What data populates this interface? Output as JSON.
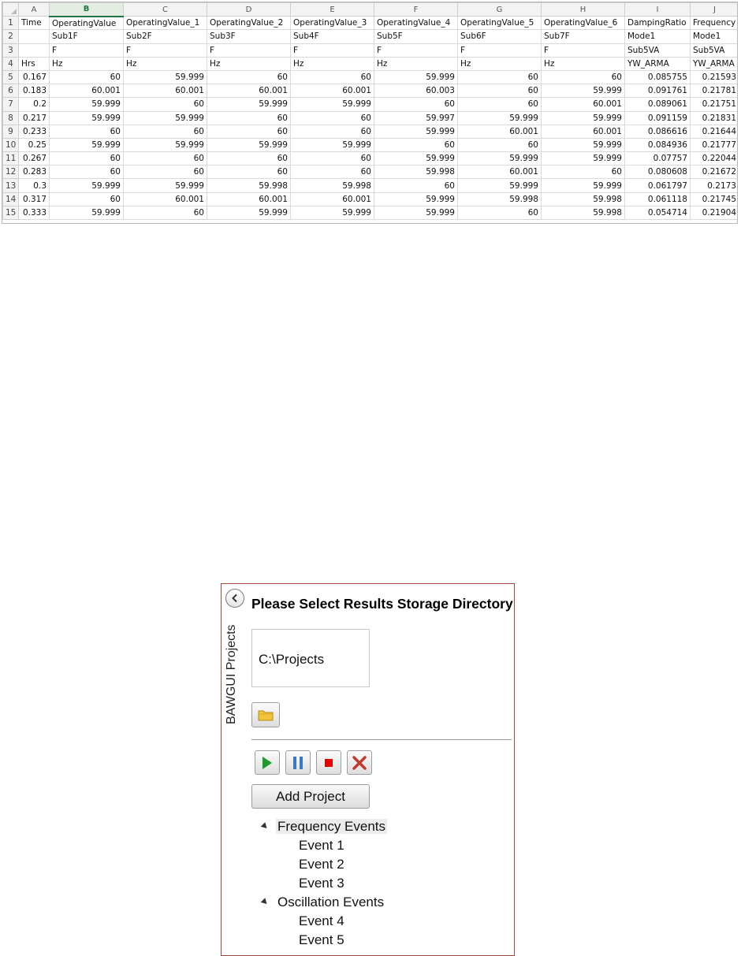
{
  "sheet": {
    "col_letters": [
      "A",
      "B",
      "C",
      "D",
      "E",
      "F",
      "G",
      "H",
      "I",
      "J"
    ],
    "rows": [
      {
        "n": "1",
        "cells": [
          "Time",
          "OperatingValue",
          "OperatingValue_1",
          "OperatingValue_2",
          "OperatingValue_3",
          "OperatingValue_4",
          "OperatingValue_5",
          "OperatingValue_6",
          "DampingRatio",
          "Frequency"
        ]
      },
      {
        "n": "2",
        "cells": [
          "",
          "Sub1F",
          "Sub2F",
          "Sub3F",
          "Sub4F",
          "Sub5F",
          "Sub6F",
          "Sub7F",
          "Mode1",
          "Mode1"
        ]
      },
      {
        "n": "3",
        "cells": [
          "",
          "F",
          "F",
          "F",
          "F",
          "F",
          "F",
          "F",
          "Sub5VA",
          "Sub5VA"
        ]
      },
      {
        "n": "4",
        "cells": [
          "Hrs",
          "Hz",
          "Hz",
          "Hz",
          "Hz",
          "Hz",
          "Hz",
          "Hz",
          "YW_ARMA",
          "YW_ARMA"
        ]
      },
      {
        "n": "5",
        "cells": [
          "0.167",
          "60",
          "59.999",
          "60",
          "60",
          "59.999",
          "60",
          "60",
          "0.085755",
          "0.21593"
        ]
      },
      {
        "n": "6",
        "cells": [
          "0.183",
          "60.001",
          "60.001",
          "60.001",
          "60.001",
          "60.003",
          "60",
          "59.999",
          "0.091761",
          "0.21781"
        ]
      },
      {
        "n": "7",
        "cells": [
          "0.2",
          "59.999",
          "60",
          "59.999",
          "59.999",
          "60",
          "60",
          "60.001",
          "0.089061",
          "0.21751"
        ]
      },
      {
        "n": "8",
        "cells": [
          "0.217",
          "59.999",
          "59.999",
          "60",
          "60",
          "59.997",
          "59.999",
          "59.999",
          "0.091159",
          "0.21831"
        ]
      },
      {
        "n": "9",
        "cells": [
          "0.233",
          "60",
          "60",
          "60",
          "60",
          "59.999",
          "60.001",
          "60.001",
          "0.086616",
          "0.21644"
        ]
      },
      {
        "n": "10",
        "cells": [
          "0.25",
          "59.999",
          "59.999",
          "59.999",
          "59.999",
          "60",
          "60",
          "59.999",
          "0.084936",
          "0.21777"
        ]
      },
      {
        "n": "11",
        "cells": [
          "0.267",
          "60",
          "60",
          "60",
          "60",
          "59.999",
          "59.999",
          "59.999",
          "0.07757",
          "0.22044"
        ]
      },
      {
        "n": "12",
        "cells": [
          "0.283",
          "60",
          "60",
          "60",
          "60",
          "59.998",
          "60.001",
          "60",
          "0.080608",
          "0.21672"
        ]
      },
      {
        "n": "13",
        "cells": [
          "0.3",
          "59.999",
          "59.999",
          "59.998",
          "59.998",
          "60",
          "59.999",
          "59.999",
          "0.061797",
          "0.2173"
        ]
      },
      {
        "n": "14",
        "cells": [
          "0.317",
          "60",
          "60.001",
          "60.001",
          "60.001",
          "59.999",
          "59.998",
          "59.998",
          "0.061118",
          "0.21745"
        ]
      },
      {
        "n": "15",
        "cells": [
          "0.333",
          "59.999",
          "60",
          "59.999",
          "59.999",
          "59.999",
          "60",
          "59.998",
          "0.054714",
          "0.21904"
        ]
      }
    ]
  },
  "panel": {
    "side_label": "BAWGUI Projects",
    "title": "Please Select Results Storage Directory",
    "directory_value": "C:\\Projects",
    "add_project_label": "Add Project",
    "icons": {
      "collapse": "chevron-left-icon",
      "browse": "folder-icon",
      "run": "play-icon",
      "pause": "pause-icon",
      "stop": "stop-icon",
      "cancel": "close-icon"
    },
    "colors": {
      "border": "#a7463c",
      "play": "#1e9a2e",
      "pause": "#3a79c7",
      "stop": "#e00000",
      "cancel": "#c0392b",
      "folder": "#f2c53d"
    },
    "tree": [
      {
        "label": "Frequency Events",
        "highlighted": true,
        "children": [
          "Event 1",
          "Event 2",
          "Event 3"
        ]
      },
      {
        "label": "Oscillation Events",
        "highlighted": false,
        "children": [
          "Event 4",
          "Event 5"
        ]
      }
    ]
  }
}
